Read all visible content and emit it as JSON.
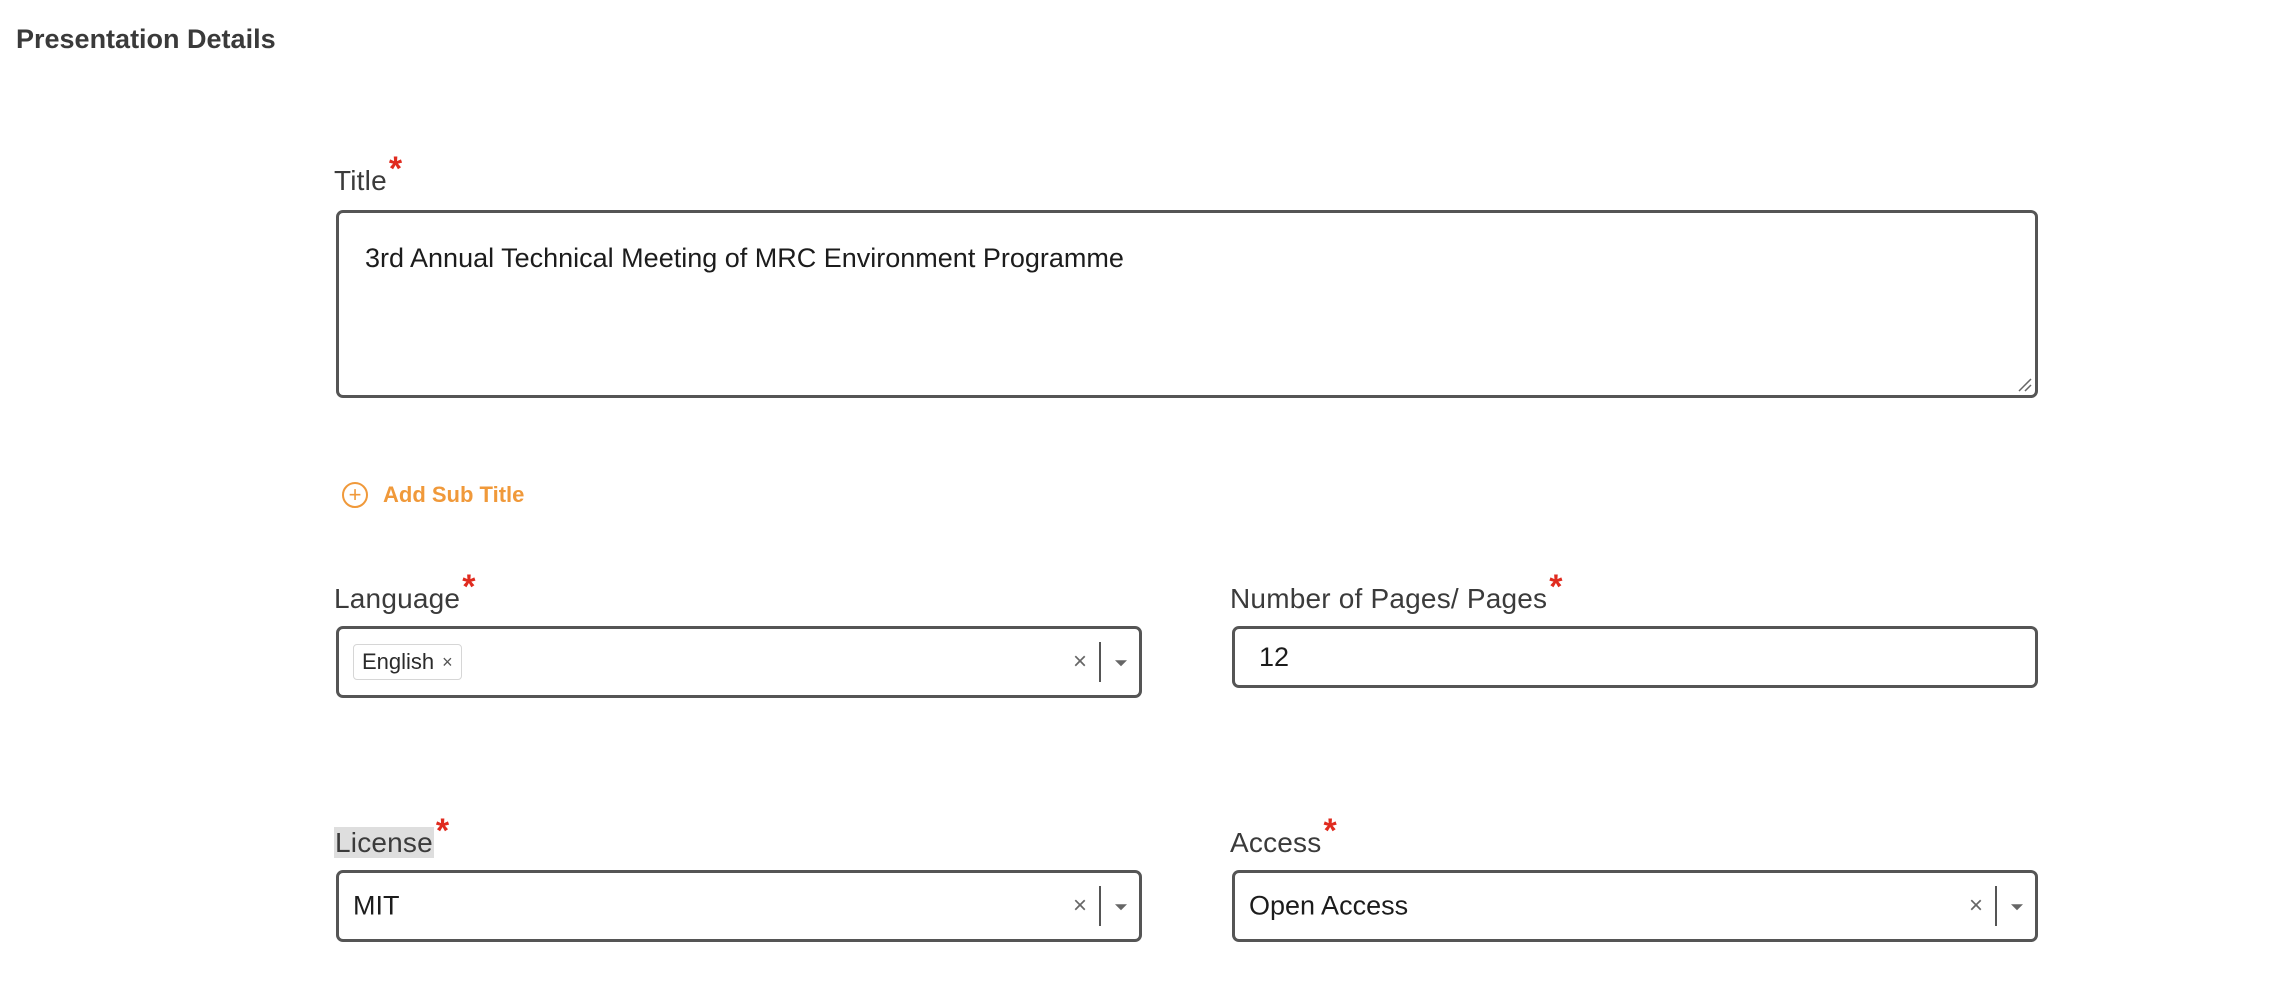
{
  "section": {
    "title": "Presentation Details"
  },
  "title_field": {
    "label": "Title",
    "required_mark": "*",
    "value": "3rd Annual Technical Meeting of MRC Environment Programme"
  },
  "add_subtitle": {
    "label": "Add Sub Title"
  },
  "language_field": {
    "label": "Language",
    "required_mark": "*",
    "chips": [
      "English"
    ],
    "chip_remove": "×",
    "clear": "×"
  },
  "pages_field": {
    "label": "Number of Pages/ Pages",
    "required_mark": "*",
    "value": "12"
  },
  "license_field": {
    "label": "License",
    "required_mark": "*",
    "value": "MIT",
    "clear": "×"
  },
  "access_field": {
    "label": "Access",
    "required_mark": "*",
    "value": "Open Access",
    "clear": "×"
  },
  "colors": {
    "accent": "#f0993a",
    "required": "#e02b1f",
    "border": "#555555"
  }
}
